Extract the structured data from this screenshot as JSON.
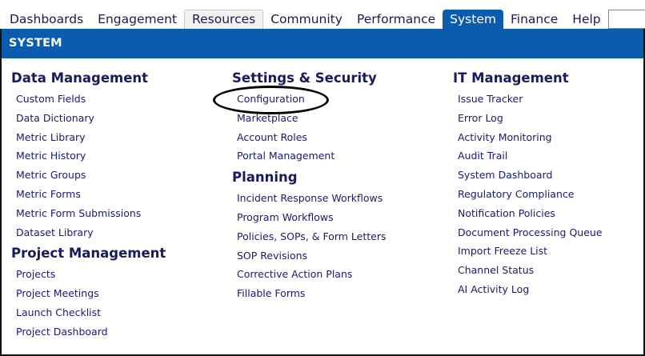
{
  "nav": {
    "tabs": [
      "Dashboards",
      "Engagement",
      "Resources",
      "Community",
      "Performance",
      "System",
      "Finance",
      "Help"
    ],
    "active": "System",
    "search_value": ""
  },
  "panel": {
    "title": "SYSTEM",
    "data_management": {
      "heading": "Data Management",
      "links": [
        "Custom Fields",
        "Data Dictionary",
        "Metric Library",
        "Metric History",
        "Metric Groups",
        "Metric Forms",
        "Metric Form Submissions",
        "Dataset Library"
      ]
    },
    "project_management": {
      "heading": "Project Management",
      "links": [
        "Projects",
        "Project Meetings",
        "Launch Checklist",
        "Project Dashboard"
      ]
    },
    "settings_security": {
      "heading": "Settings & Security",
      "links": [
        "Configuration",
        "Marketplace",
        "Account Roles",
        "Portal Management"
      ]
    },
    "planning": {
      "heading": "Planning",
      "links": [
        "Incident Response Workflows",
        "Program Workflows",
        "Policies, SOPs, & Form Letters",
        "SOP Revisions",
        "Corrective Action Plans",
        "Fillable Forms"
      ]
    },
    "it_management": {
      "heading": "IT Management",
      "links": [
        "Issue Tracker",
        "Error Log",
        "Activity Monitoring",
        "Audit Trail",
        "System Dashboard",
        "Regulatory Compliance",
        "Notification Policies",
        "Document Processing Queue",
        "Import Freeze List",
        "Channel Status",
        "AI Activity Log"
      ]
    }
  }
}
